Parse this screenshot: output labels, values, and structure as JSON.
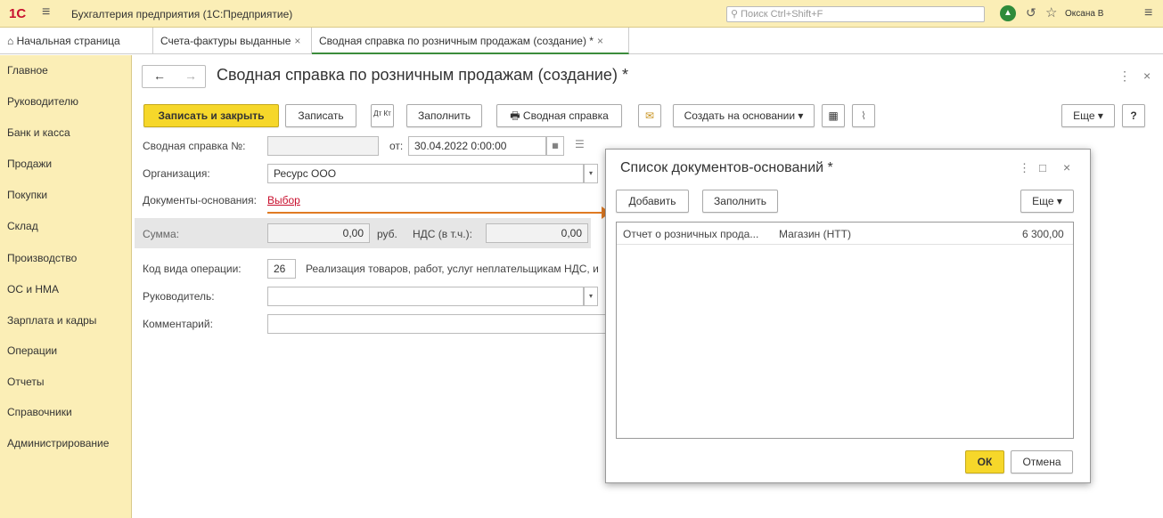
{
  "app": {
    "logo": "1С",
    "title": "Бухгалтерия предприятия  (1С:Предприятие)",
    "search_placeholder": "Поиск Ctrl+Shift+F",
    "user": "Оксана В"
  },
  "tabs": [
    {
      "label": "Начальная страница"
    },
    {
      "label": "Счета-фактуры выданные"
    },
    {
      "label": "Сводная справка по розничным продажам (создание) *"
    }
  ],
  "sidebar": {
    "items": [
      {
        "label": "Главное"
      },
      {
        "label": "Руководителю"
      },
      {
        "label": "Банк и касса"
      },
      {
        "label": "Продажи"
      },
      {
        "label": "Покупки"
      },
      {
        "label": "Склад"
      },
      {
        "label": "Производство"
      },
      {
        "label": "ОС и НМА"
      },
      {
        "label": "Зарплата и кадры"
      },
      {
        "label": "Операции"
      },
      {
        "label": "Отчеты"
      },
      {
        "label": "Справочники"
      },
      {
        "label": "Администрирование"
      }
    ]
  },
  "form": {
    "title": "Сводная справка по розничным продажам (создание) *",
    "toolbar": {
      "save_close": "Записать и закрыть",
      "save": "Записать",
      "dtkt": "Дт Кт",
      "fill": "Заполнить",
      "print": "Сводная справка",
      "create_based": "Создать на основании",
      "more": "Еще",
      "help": "?"
    },
    "number_label": "Сводная справка №:",
    "number_value": "",
    "date_label": "от:",
    "date_value": "30.04.2022  0:00:00",
    "org_label": "Организация:",
    "org_value": "Ресурс ООО",
    "docs_label": "Документы-основания:",
    "docs_link": "Выбор",
    "sum_label": "Сумма:",
    "sum_value": "0,00",
    "currency": "руб.",
    "vat_label": "НДС (в т.ч.):",
    "vat_value": "0,00",
    "opcode_label": "Код вида операции:",
    "opcode_value": "26",
    "opcode_desc": "Реализация товаров, работ, услуг неплательщикам НДС, и",
    "manager_label": "Руководитель:",
    "manager_value": "",
    "comment_label": "Комментарий:",
    "comment_value": ""
  },
  "dialog": {
    "title": "Список документов-оснований *",
    "add": "Добавить",
    "fill": "Заполнить",
    "more": "Еще",
    "rows": [
      {
        "document": "Отчет о розничных прода...",
        "store": "Магазин (НТТ)",
        "amount": "6 300,00"
      }
    ],
    "ok": "ОК",
    "cancel": "Отмена"
  },
  "colors": {
    "accent_yellow": "#f6d72a",
    "panel": "#fbeeb6",
    "link": "#c8102e",
    "arrow": "#e07b23"
  }
}
